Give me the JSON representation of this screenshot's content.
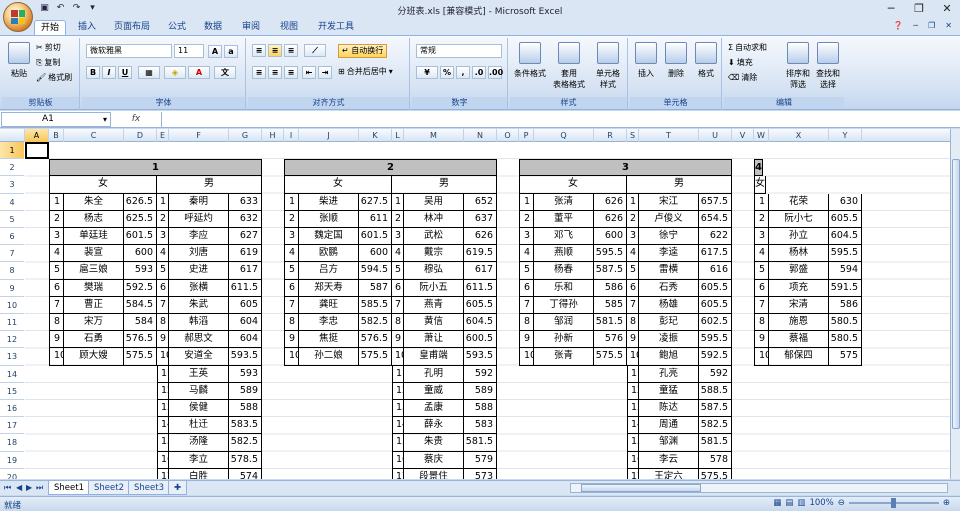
{
  "window": {
    "title": "分班表.xls  [兼容模式] - Microsoft Excel"
  },
  "ribbon_tabs": [
    "开始",
    "插入",
    "页面布局",
    "公式",
    "数据",
    "审阅",
    "视图",
    "开发工具"
  ],
  "ribbon": {
    "clipboard": {
      "paste": "粘贴",
      "cut": "剪切",
      "copy": "复制",
      "format_painter": "格式刷",
      "label": "剪贴板"
    },
    "font": {
      "name": "微软雅黑",
      "size": "11",
      "label": "字体"
    },
    "alignment": {
      "wrap": "自动换行",
      "merge": "合并后居中",
      "label": "对齐方式"
    },
    "number": {
      "format": "常规",
      "label": "数字"
    },
    "styles": {
      "conditional": "条件格式",
      "table": "套用\n表格格式",
      "cell": "单元格\n样式",
      "label": "样式"
    },
    "cells": {
      "insert": "插入",
      "delete": "删除",
      "format": "格式",
      "label": "单元格"
    },
    "editing": {
      "autosum": "自动求和",
      "fill": "填充",
      "clear": "清除",
      "sort": "排序和\n筛选",
      "find": "查找和\n选择",
      "label": "编辑"
    }
  },
  "formula_bar": {
    "name_box": "A1",
    "fx": "fx",
    "content": ""
  },
  "columns": [
    "A",
    "B",
    "C",
    "D",
    "E",
    "F",
    "G",
    "H",
    "I",
    "J",
    "K",
    "L",
    "M",
    "N",
    "O",
    "P",
    "Q",
    "R",
    "S",
    "T",
    "U",
    "V",
    "W",
    "X",
    "Y"
  ],
  "rows": [
    "1",
    "2",
    "3",
    "4",
    "5",
    "6",
    "7",
    "8",
    "9",
    "10",
    "11",
    "12",
    "13",
    "14",
    "15",
    "16",
    "17",
    "18",
    "19",
    "20"
  ],
  "classes": [
    {
      "title": "1",
      "female_label": "女",
      "male_label": "男",
      "female": [
        [
          "1",
          "朱全",
          "626.5"
        ],
        [
          "2",
          "杨志",
          "625.5"
        ],
        [
          "3",
          "单廷珪",
          "601.5"
        ],
        [
          "4",
          "裴宣",
          "600"
        ],
        [
          "5",
          "扈三娘",
          "593"
        ],
        [
          "6",
          "樊瑞",
          "592.5"
        ],
        [
          "7",
          "曹正",
          "584.5"
        ],
        [
          "8",
          "宋万",
          "584"
        ],
        [
          "9",
          "石勇",
          "576.5"
        ],
        [
          "10",
          "顾大嫂",
          "575.5"
        ]
      ],
      "male": [
        [
          "1",
          "秦明",
          "633"
        ],
        [
          "2",
          "呼延灼",
          "632"
        ],
        [
          "3",
          "李应",
          "627"
        ],
        [
          "4",
          "刘唐",
          "619"
        ],
        [
          "5",
          "史进",
          "617"
        ],
        [
          "6",
          "张横",
          "611.5"
        ],
        [
          "7",
          "朱武",
          "605"
        ],
        [
          "8",
          "韩滔",
          "604"
        ],
        [
          "9",
          "郝思文",
          "604"
        ],
        [
          "10",
          "安道全",
          "593.5"
        ],
        [
          "11",
          "王英",
          "593"
        ],
        [
          "12",
          "马麟",
          "589"
        ],
        [
          "13",
          "侯健",
          "588"
        ],
        [
          "14",
          "杜迁",
          "583.5"
        ],
        [
          "15",
          "汤隆",
          "582.5"
        ],
        [
          "16",
          "李立",
          "578.5"
        ],
        [
          "17",
          "白胜",
          "574"
        ]
      ]
    },
    {
      "title": "2",
      "female_label": "女",
      "male_label": "男",
      "female": [
        [
          "1",
          "柴进",
          "627.5"
        ],
        [
          "2",
          "张顺",
          "611"
        ],
        [
          "3",
          "魏定国",
          "601.5"
        ],
        [
          "4",
          "欧鹏",
          "600"
        ],
        [
          "5",
          "吕方",
          "594.5"
        ],
        [
          "6",
          "郑天寿",
          "587"
        ],
        [
          "7",
          "龚旺",
          "585.5"
        ],
        [
          "8",
          "李忠",
          "582.5"
        ],
        [
          "9",
          "焦挺",
          "576.5"
        ],
        [
          "10",
          "孙二娘",
          "575.5"
        ]
      ],
      "male": [
        [
          "1",
          "吴用",
          "652"
        ],
        [
          "2",
          "林冲",
          "637"
        ],
        [
          "3",
          "武松",
          "626"
        ],
        [
          "4",
          "戴宗",
          "619.5"
        ],
        [
          "5",
          "穆弘",
          "617"
        ],
        [
          "6",
          "阮小五",
          "611.5"
        ],
        [
          "7",
          "燕青",
          "605.5"
        ],
        [
          "8",
          "黄信",
          "604.5"
        ],
        [
          "9",
          "萧让",
          "600.5"
        ],
        [
          "10",
          "皇甫端",
          "593.5"
        ],
        [
          "11",
          "孔明",
          "592"
        ],
        [
          "12",
          "童威",
          "589"
        ],
        [
          "13",
          "孟康",
          "588"
        ],
        [
          "14",
          "薛永",
          "583"
        ],
        [
          "15",
          "朱贵",
          "581.5"
        ],
        [
          "16",
          "蔡庆",
          "579"
        ],
        [
          "17",
          "段景住",
          "573"
        ]
      ]
    },
    {
      "title": "3",
      "female_label": "女",
      "male_label": "男",
      "female": [
        [
          "1",
          "张清",
          "626"
        ],
        [
          "2",
          "董平",
          "626"
        ],
        [
          "3",
          "邓飞",
          "600"
        ],
        [
          "4",
          "燕顺",
          "595.5"
        ],
        [
          "5",
          "杨春",
          "587.5"
        ],
        [
          "6",
          "乐和",
          "586"
        ],
        [
          "7",
          "丁得孙",
          "585"
        ],
        [
          "8",
          "邹润",
          "581.5"
        ],
        [
          "9",
          "孙新",
          "576"
        ],
        [
          "10",
          "张青",
          "575.5"
        ]
      ],
      "male": [
        [
          "1",
          "宋江",
          "657.5"
        ],
        [
          "2",
          "卢俊义",
          "654.5"
        ],
        [
          "3",
          "徐宁",
          "622"
        ],
        [
          "4",
          "李逵",
          "617.5"
        ],
        [
          "5",
          "雷横",
          "616"
        ],
        [
          "6",
          "石秀",
          "605.5"
        ],
        [
          "7",
          "杨雄",
          "605.5"
        ],
        [
          "8",
          "彭玘",
          "602.5"
        ],
        [
          "9",
          "凌振",
          "595.5"
        ],
        [
          "10",
          "鲍旭",
          "592.5"
        ],
        [
          "11",
          "孔亮",
          "592"
        ],
        [
          "12",
          "童猛",
          "588.5"
        ],
        [
          "13",
          "陈达",
          "587.5"
        ],
        [
          "14",
          "周通",
          "582.5"
        ],
        [
          "15",
          "邹渊",
          "581.5"
        ],
        [
          "16",
          "李云",
          "578"
        ],
        [
          "17",
          "王定六",
          "575.5"
        ]
      ]
    },
    {
      "title": "4",
      "female_label": "女",
      "female": [
        [
          "1",
          "花荣",
          "630"
        ],
        [
          "2",
          "阮小七",
          "605.5"
        ],
        [
          "3",
          "孙立",
          "604.5"
        ],
        [
          "4",
          "杨林",
          "595.5"
        ],
        [
          "5",
          "郭盛",
          "594"
        ],
        [
          "6",
          "项充",
          "591.5"
        ],
        [
          "7",
          "宋清",
          "586"
        ],
        [
          "8",
          "施恩",
          "580.5"
        ],
        [
          "9",
          "蔡福",
          "580.5"
        ],
        [
          "10",
          "郁保四",
          "575"
        ]
      ]
    }
  ],
  "sheet_tabs": [
    "Sheet1",
    "Sheet2",
    "Sheet3"
  ],
  "status": {
    "ready": "就绪",
    "zoom": "100%"
  }
}
